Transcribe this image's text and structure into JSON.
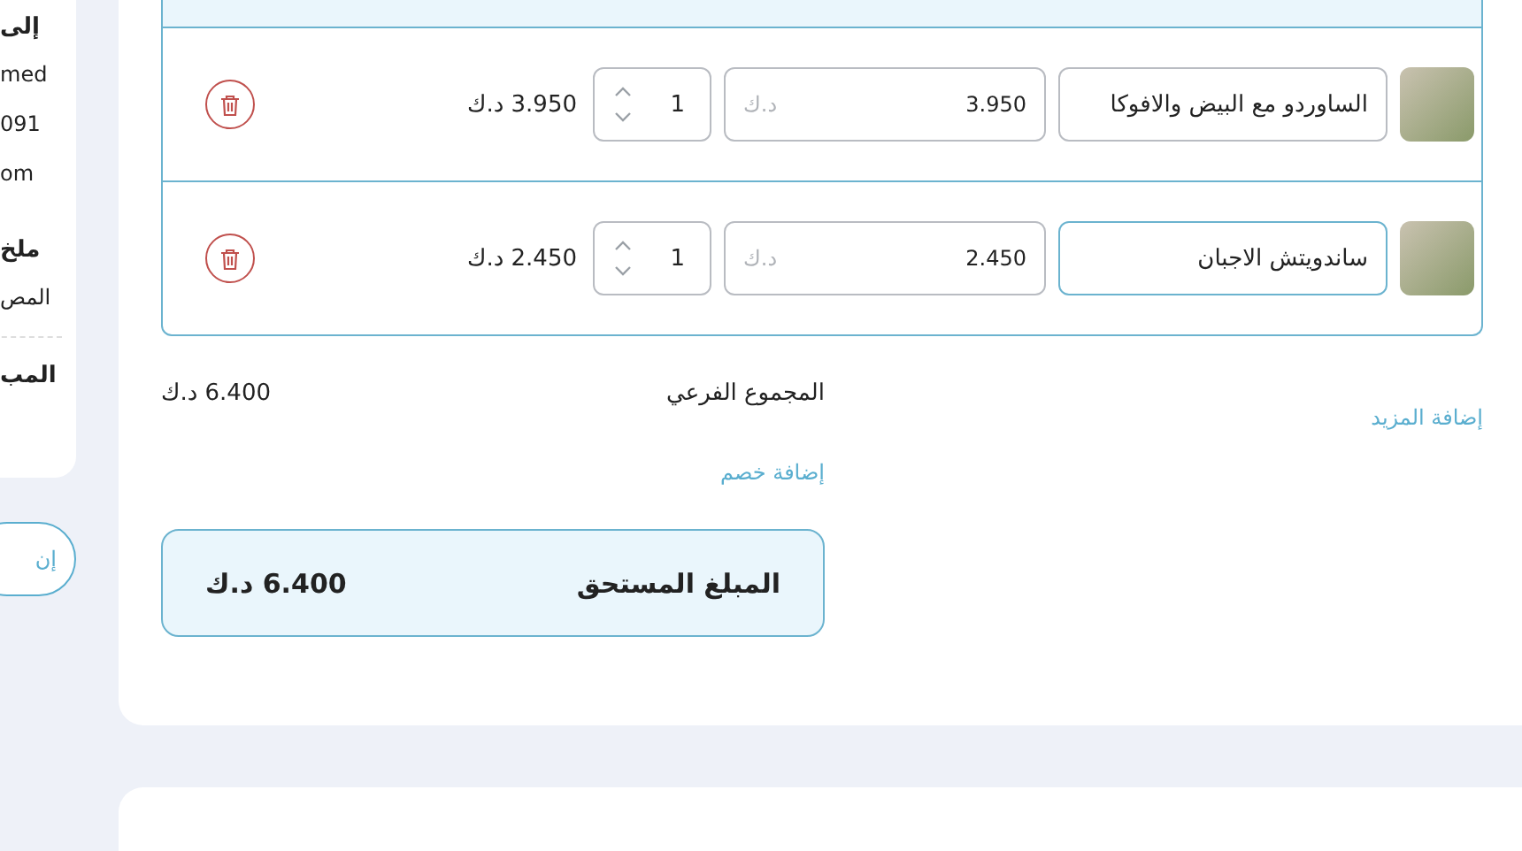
{
  "sidebar": {
    "title": "إلى",
    "lines": [
      "med",
      "091",
      "om"
    ],
    "summary_title": "ملخ",
    "summary_line": "المص",
    "total_label": "المب",
    "button": "إن"
  },
  "items": [
    {
      "name": "الساوردو مع البيض والافوكا",
      "price": "3.950",
      "currency_placeholder": "د.ك",
      "quantity": "1",
      "total": "3.950 د.ك"
    },
    {
      "name": "ساندويتش الاجبان",
      "price": "2.450",
      "currency_placeholder": "د.ك",
      "quantity": "1",
      "total": "2.450 د.ك"
    }
  ],
  "add_more": "إضافة المزيد",
  "subtotal": {
    "label": "المجموع الفرعي",
    "value": "6.400 د.ك"
  },
  "add_discount": "إضافة خصم",
  "amount_due": {
    "label": "المبلغ المستحق",
    "value": "6.400 د.ك"
  }
}
